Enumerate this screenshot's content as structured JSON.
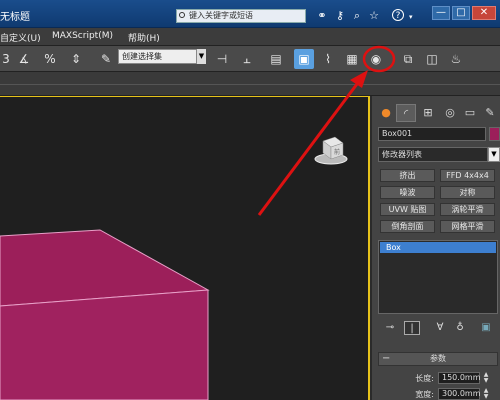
{
  "titlebar": {
    "title": "无标题",
    "search_placeholder": "键入关键字或短语",
    "icons": [
      "binoculars-icon",
      "key-icon",
      "magnify-icon",
      "star-icon",
      "help-icon"
    ],
    "help_symbol": "?",
    "minimize": "—",
    "restore": "□",
    "close": "✕"
  },
  "menubar": {
    "items": [
      "自定义(U)",
      "MAXScript(M)",
      "帮助(H)"
    ]
  },
  "toolbar": {
    "selection_set": "创建选择集",
    "fragments": [
      "3",
      "%"
    ],
    "accent": "#5aa0e0"
  },
  "viewport": {
    "box_color": "#9c1f5a",
    "cube_face": "前"
  },
  "panel": {
    "object_name": "Box001",
    "object_color": "#9c1f5a",
    "modifier_list": "修改器列表",
    "modifier_buttons": [
      {
        "left": "挤出",
        "right": "FFD 4x4x4"
      },
      {
        "left": "噪波",
        "right": "对称"
      },
      {
        "left": "UVW 贴图",
        "right": "涡轮平滑"
      },
      {
        "left": "倒角剖面",
        "right": "网格平滑"
      }
    ],
    "stack_item": "Box",
    "params_title": "参数",
    "params": [
      {
        "label": "长度:",
        "value": "150.0mm"
      },
      {
        "label": "宽度:",
        "value": "300.0mm"
      }
    ]
  },
  "annotation": {
    "color": "#dd1111"
  }
}
